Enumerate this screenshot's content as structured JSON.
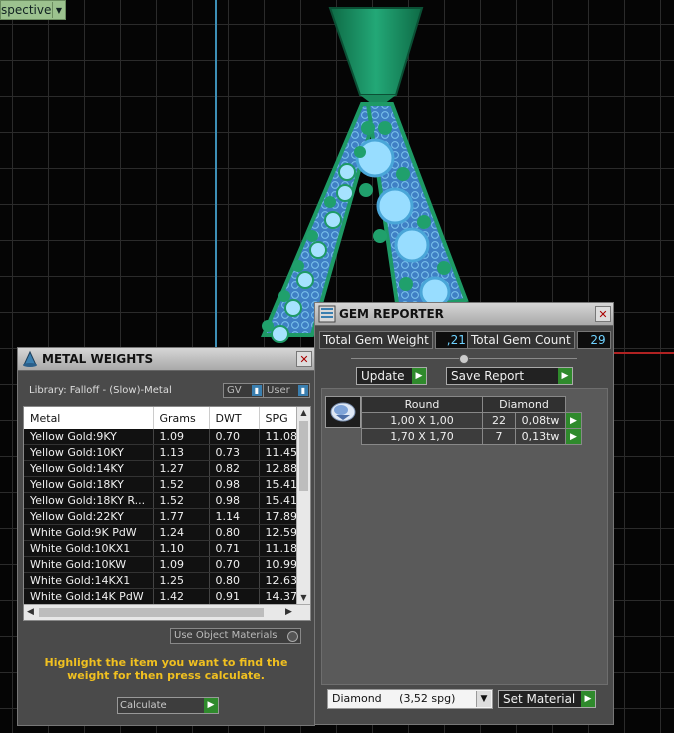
{
  "viewport": {
    "view_label": "spective"
  },
  "metal_weights": {
    "title": "METAL WEIGHTS",
    "library": "Library: Falloff - (Slow)-Metal",
    "gv_toggle": "GV",
    "user_toggle": "User",
    "columns": [
      "Metal",
      "Grams",
      "DWT",
      "SPG"
    ],
    "rows": [
      [
        "Yellow Gold:9KY",
        "1.09",
        "0.70",
        "11.08"
      ],
      [
        "Yellow Gold:10KY",
        "1.13",
        "0.73",
        "11.45"
      ],
      [
        "Yellow Gold:14KY",
        "1.27",
        "0.82",
        "12.88"
      ],
      [
        "Yellow Gold:18KY",
        "1.52",
        "0.98",
        "15.41"
      ],
      [
        "Yellow Gold:18KY R...",
        "1.52",
        "0.98",
        "15.41"
      ],
      [
        "Yellow Gold:22KY",
        "1.77",
        "1.14",
        "17.89"
      ],
      [
        "White Gold:9K PdW",
        "1.24",
        "0.80",
        "12.59"
      ],
      [
        "White Gold:10KX1",
        "1.10",
        "0.71",
        "11.18"
      ],
      [
        "White Gold:10KW",
        "1.09",
        "0.70",
        "10.99"
      ],
      [
        "White Gold:14KX1",
        "1.25",
        "0.80",
        "12.63"
      ],
      [
        "White Gold:14K PdW",
        "1.42",
        "0.91",
        "14.37"
      ]
    ],
    "use_object_materials": "Use Object Materials",
    "hint": "Highlight the item you want to find the weight for then press calculate.",
    "calculate_label": "Calculate"
  },
  "gem_reporter": {
    "title": "GEM REPORTER",
    "total_weight_label": "Total Gem Weight",
    "total_weight_value": ",21",
    "total_count_label": "Total Gem Count",
    "total_count_value": "29",
    "update_label": "Update",
    "save_report_label": "Save Report",
    "table": {
      "headers": [
        "Round",
        "Diamond"
      ],
      "rows": [
        [
          "1,00 X 1,00",
          "22",
          "0,08tw"
        ],
        [
          "1,70 X 1,70",
          "7",
          "0,13tw"
        ]
      ]
    },
    "material_select": "Diamond     (3,52 spg)",
    "set_material_label": "Set Material"
  },
  "colors": {
    "accent_green": "#2f8a2c",
    "gem_blue": "#6fd2ff",
    "hint_yellow": "#f0c020",
    "metal_green": "#1fa070"
  }
}
